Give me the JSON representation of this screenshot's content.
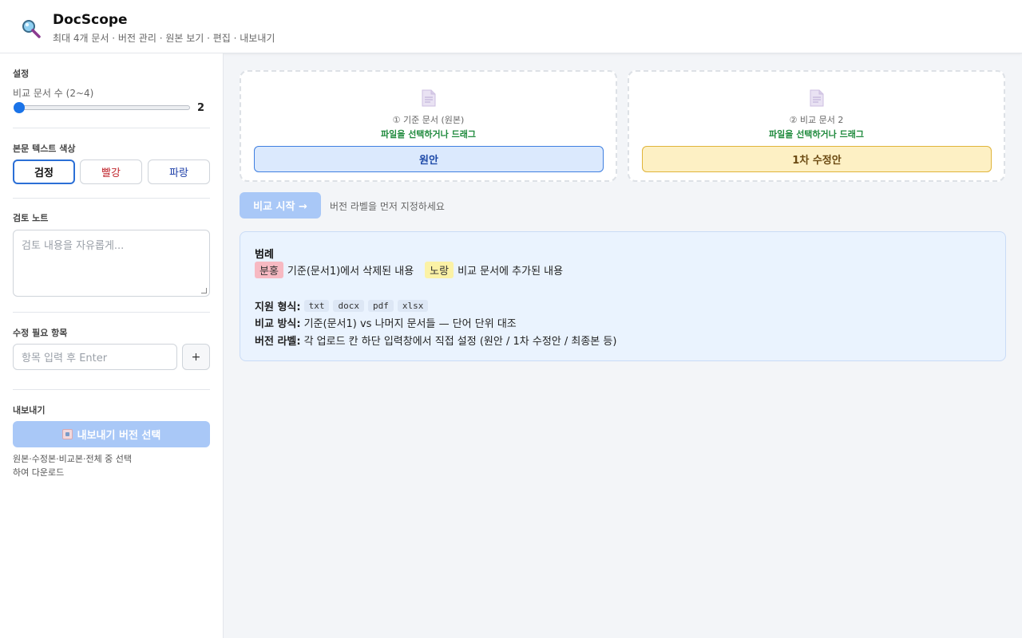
{
  "header": {
    "title": "DocScope",
    "subtitle": "최대 4개 문서 · 버전 관리 · 원본 보기 · 편집 · 내보내기"
  },
  "sidebar": {
    "settings": {
      "title": "설정",
      "doc_count_label": "비교 문서 수 (2~4)",
      "doc_count_value": "2",
      "doc_count_level": 2,
      "doc_count_min": 2,
      "doc_count_max": 4
    },
    "text_color": {
      "title": "본문 텍스트 색상",
      "options": [
        "검정",
        "빨강",
        "파랑"
      ],
      "selected": "검정"
    },
    "notes": {
      "title": "검토 노트",
      "placeholder": "검토 내용을 자유롭게..."
    },
    "fix_items": {
      "title": "수정 필요 항목",
      "placeholder": "항목 입력 후 Enter",
      "add_label": "+"
    },
    "export": {
      "title": "내보내기",
      "button_label": "내보내기 버전 선택",
      "hint": "원본·수정본·비교본·전체 중 선택하여 다운로드"
    }
  },
  "uploads": [
    {
      "label": "① 기준 문서 (원본)",
      "hint": "파일을 선택하거나 드래그",
      "version": "원안"
    },
    {
      "label": "② 비교 문서 2",
      "hint": "파일을 선택하거나 드래그",
      "version": "1차 수정안"
    }
  ],
  "actions": {
    "start_label": "비교 시작 →",
    "start_hint": "버전 라벨을 먼저 지정하세요"
  },
  "legend": {
    "title": "범례",
    "deleted_chip": "분홍",
    "deleted_text": "기준(문서1)에서 삭제된 내용",
    "added_chip": "노랑",
    "added_text": "비교 문서에 추가된 내용",
    "formats_label": "지원 형식:",
    "formats": [
      "txt",
      "docx",
      "pdf",
      "xlsx"
    ],
    "method_label": "비교 방식:",
    "method_text": "기준(문서1) vs 나머지 문서들 — 단어 단위 대조",
    "version_label": "버전 라벨:",
    "version_text": "각 업로드 칸 하단 입력창에서 직접 설정 (원안 / 1차 수정안 / 최종본 등)"
  },
  "colors": {
    "accent": "#1a73e8",
    "disabled_button": "#a9c8f7",
    "hint_green": "#1f8a3d",
    "deleted": "#f7b9c2",
    "added": "#fbf2a6",
    "legend_bg": "#eaf3fe"
  },
  "icons": {
    "logo": "magnifier-icon",
    "document": "document-icon",
    "export": "calendar-icon"
  }
}
